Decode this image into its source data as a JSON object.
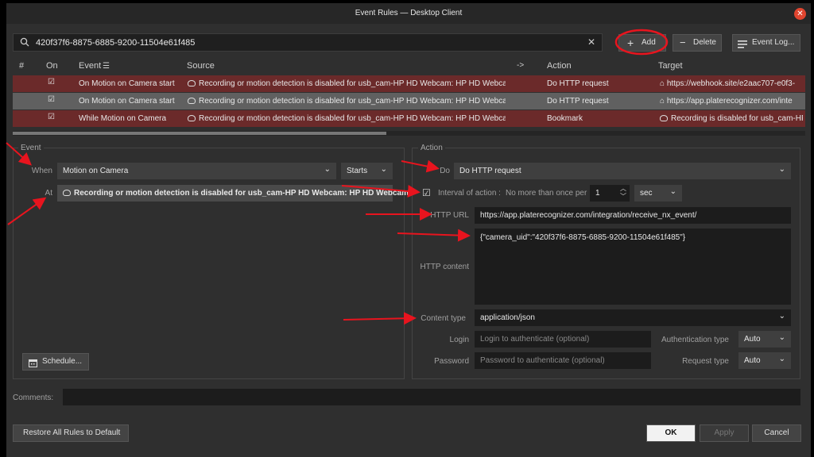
{
  "window": {
    "title": "Event Rules — Desktop Client"
  },
  "search": {
    "value": "420f37f6-8875-6885-9200-11504e61f485"
  },
  "toolbar": {
    "add_label": "Add",
    "delete_label": "Delete",
    "log_label": "Event Log..."
  },
  "table": {
    "headers": {
      "num": "#",
      "on": "On",
      "event": "Event",
      "source": "Source",
      "arrow": "->",
      "action": "Action",
      "target": "Target"
    },
    "rows": [
      {
        "event": "On Motion on Camera start",
        "source": "Recording or motion detection is disabled for usb_cam-HP HD Webcam: HP HD Webcam",
        "action": "Do HTTP request",
        "target": "https://webhook.site/e2aac707-e0f3-"
      },
      {
        "event": "On Motion on Camera start",
        "source": "Recording or motion detection is disabled for usb_cam-HP HD Webcam: HP HD Webcam",
        "action": "Do HTTP request",
        "target": "https://app.platerecognizer.com/inte"
      },
      {
        "event": "While Motion on Camera",
        "source": "Recording or motion detection is disabled for usb_cam-HP HD Webcam: HP HD Webcam",
        "action": "Bookmark",
        "target": "Recording is disabled for usb_cam-HP"
      }
    ]
  },
  "event": {
    "group_label": "Event",
    "when_label": "When",
    "when_value": "Motion on Camera",
    "starts_value": "Starts",
    "at_label": "At",
    "at_value": "Recording or motion detection is disabled for usb_cam-HP HD Webcam: HP HD Webcam",
    "schedule_label": "Schedule..."
  },
  "action": {
    "group_label": "Action",
    "do_label": "Do",
    "do_value": "Do HTTP request",
    "interval_label": "Interval of action :",
    "interval_desc": "No more than once per",
    "interval_value": "1",
    "interval_unit": "sec",
    "url_label": "HTTP URL",
    "url_value": "https://app.platerecognizer.com/integration/receive_nx_event/",
    "content_label": "HTTP content",
    "content_value": "{\"camera_uid\":\"420f37f6-8875-6885-9200-11504e61f485\"}",
    "ctype_label": "Content type",
    "ctype_value": "application/json",
    "login_label": "Login",
    "login_placeholder": "Login to authenticate (optional)",
    "password_label": "Password",
    "password_placeholder": "Password to authenticate (optional)",
    "auth_label": "Authentication type",
    "auth_value": "Auto",
    "reqtype_label": "Request type",
    "reqtype_value": "Auto"
  },
  "comments": {
    "label": "Comments:"
  },
  "footer": {
    "restore_label": "Restore All Rules to Default",
    "ok_label": "OK",
    "apply_label": "Apply",
    "cancel_label": "Cancel"
  },
  "colors": {
    "row_error": "#6b2a2a",
    "row_selected": "#606060",
    "annotation": "#e8141e",
    "close": "#e0452f"
  }
}
